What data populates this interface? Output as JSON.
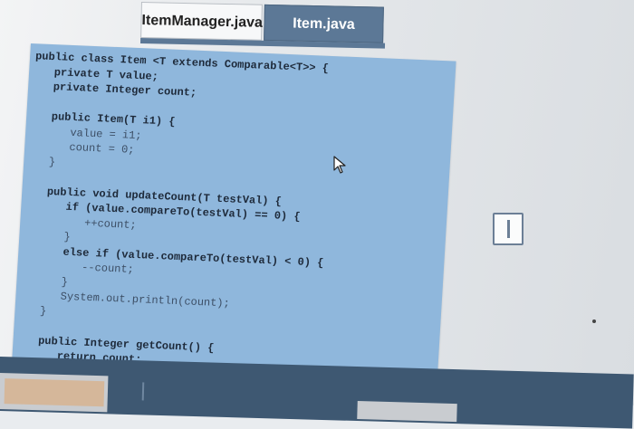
{
  "tabs": [
    {
      "label": "ItemManager.java",
      "active": false
    },
    {
      "label": "Item.java",
      "active": true
    }
  ],
  "code_lines": [
    "public class Item <T extends Comparable<T>> {",
    "   private T value;",
    "   private Integer count;",
    "",
    "   public Item(T i1) {",
    "      value = i1;",
    "      count = 0;",
    "   }",
    "",
    "   public void updateCount(T testVal) {",
    "      if (value.compareTo(testVal) == 0) {",
    "         ++count;",
    "      }",
    "      else if (value.compareTo(testVal) < 0) {",
    "         --count;",
    "      }",
    "      System.out.println(count);",
    "   }",
    "",
    "   public Integer getCount() {",
    "      return count;",
    "   }",
    "}"
  ],
  "colors": {
    "editor_bg": "#8fb7dc",
    "active_tab": "#5c7896",
    "code_text": "#3d4f66"
  }
}
